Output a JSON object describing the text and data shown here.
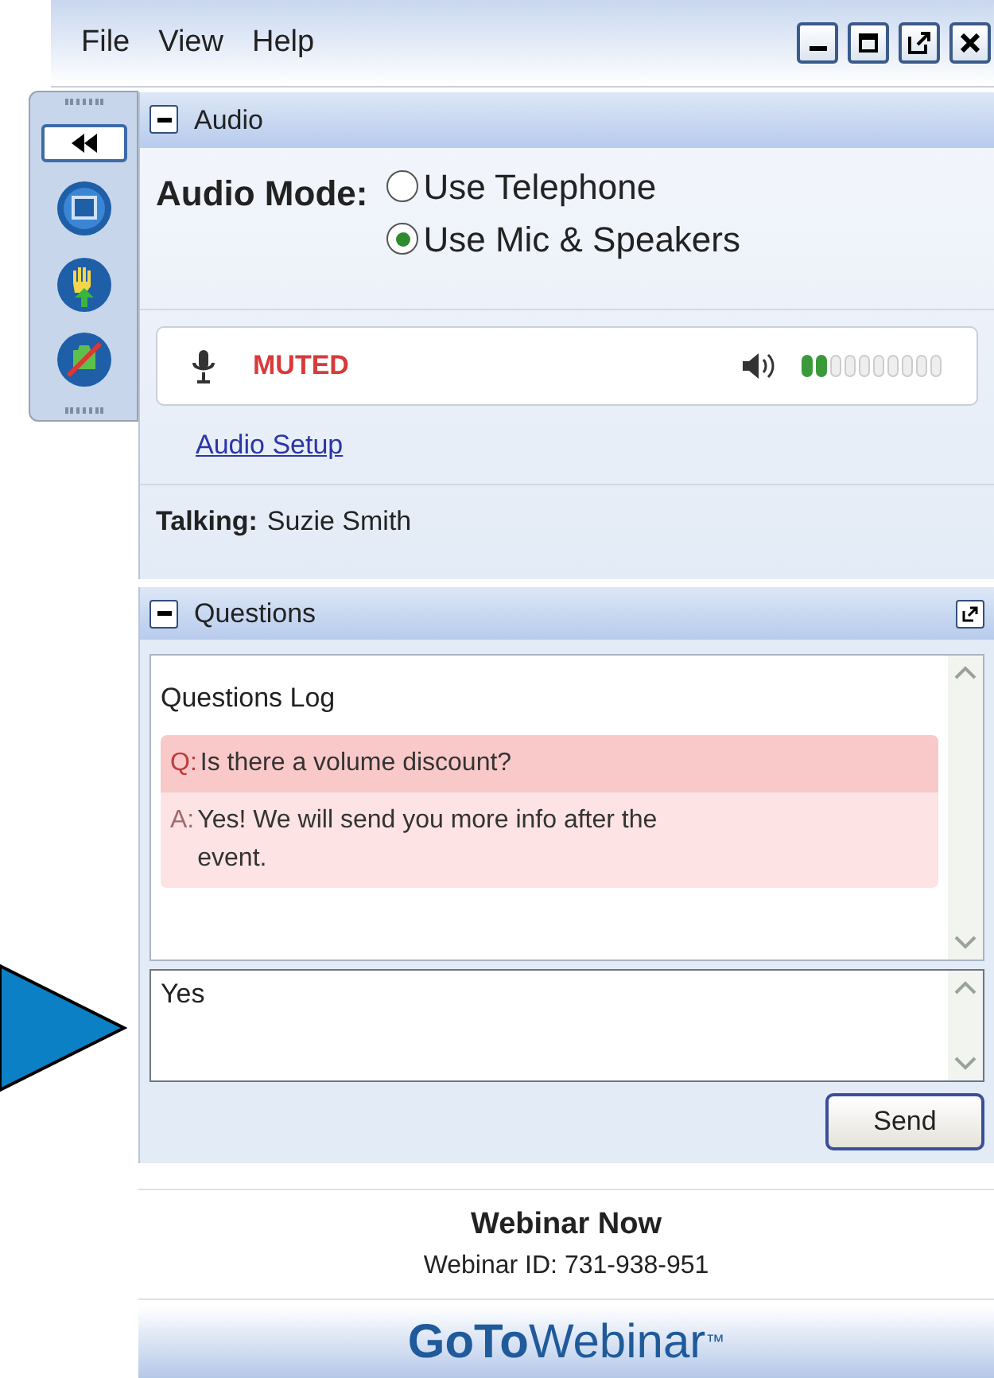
{
  "menu": [
    "File",
    "View",
    "Help"
  ],
  "audio": {
    "title": "Audio",
    "expanded": true,
    "mode_label": "Audio Mode:",
    "options": [
      {
        "label": "Use Telephone",
        "selected": false
      },
      {
        "label": "Use Mic & Speakers",
        "selected": true
      }
    ],
    "mic_status": "MUTED",
    "speaker_meter": {
      "level": 0.2
    },
    "setup_link": "Audio Setup",
    "talking_label": "Talking:",
    "talking_name": "Suzie Smith"
  },
  "questions": {
    "title": "Questions",
    "expanded": true,
    "log_title": "Questions Log",
    "entries": [
      {
        "kind": "question",
        "prefix": "Q:",
        "text": "Is there a volume discount?"
      },
      {
        "kind": "answer",
        "prefix": "A:",
        "text": "Yes! We will send you more info after the event."
      }
    ],
    "input_value": "Yes",
    "send": "Send"
  },
  "webinar": {
    "name": "Webinar Now",
    "id_text": "Webinar ID: 731-938-951"
  },
  "logo": {
    "bold": "GoTo",
    "light": "Webinar",
    "mark": "™"
  }
}
